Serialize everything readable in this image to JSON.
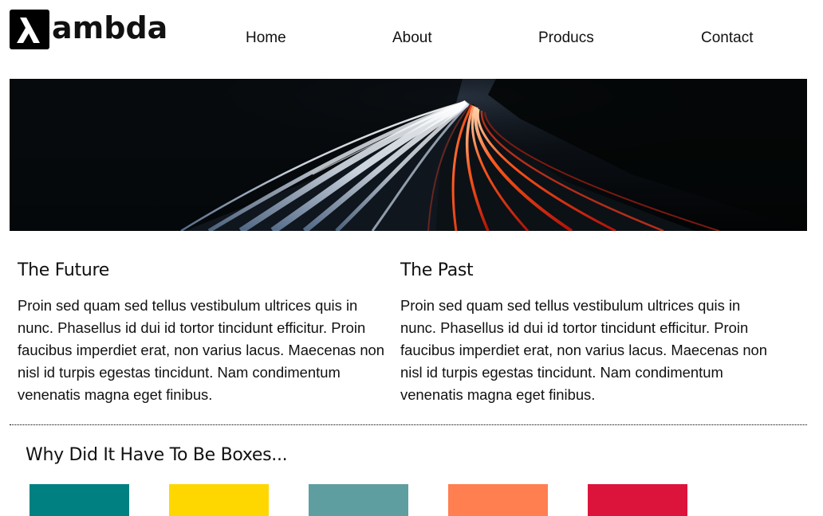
{
  "header": {
    "logo_text": "ambda",
    "logo_icon": "lambda-icon",
    "nav": [
      {
        "label": "Home"
      },
      {
        "label": "About"
      },
      {
        "label": "Producs"
      },
      {
        "label": "Contact"
      }
    ]
  },
  "hero": {
    "image": "highway-light-trails-night"
  },
  "sections": [
    {
      "title": "The Future",
      "body": "Proin sed quam sed tellus vestibulum ultrices quis in nunc. Phasellus id dui id tortor tincidunt efficitur. Proin faucibus imperdiet erat, non varius lacus. Maecenas non nisl id turpis egestas tincidunt. Nam condimentum venenatis magna eget finibus."
    },
    {
      "title": "The Past",
      "body": "Proin sed quam sed tellus vestibulum ultrices quis in nunc. Phasellus id dui id tortor tincidunt efficitur. Proin faucibus imperdiet erat, non varius lacus. Maecenas non nisl id turpis egestas tincidunt. Nam condimentum venenatis magna eget finibus."
    }
  ],
  "boxes": {
    "title": "Why Did It Have To Be Boxes...",
    "colors": [
      "#008080",
      "#FFD700",
      "#5F9EA0",
      "#FF7F50",
      "#DC143C"
    ]
  }
}
